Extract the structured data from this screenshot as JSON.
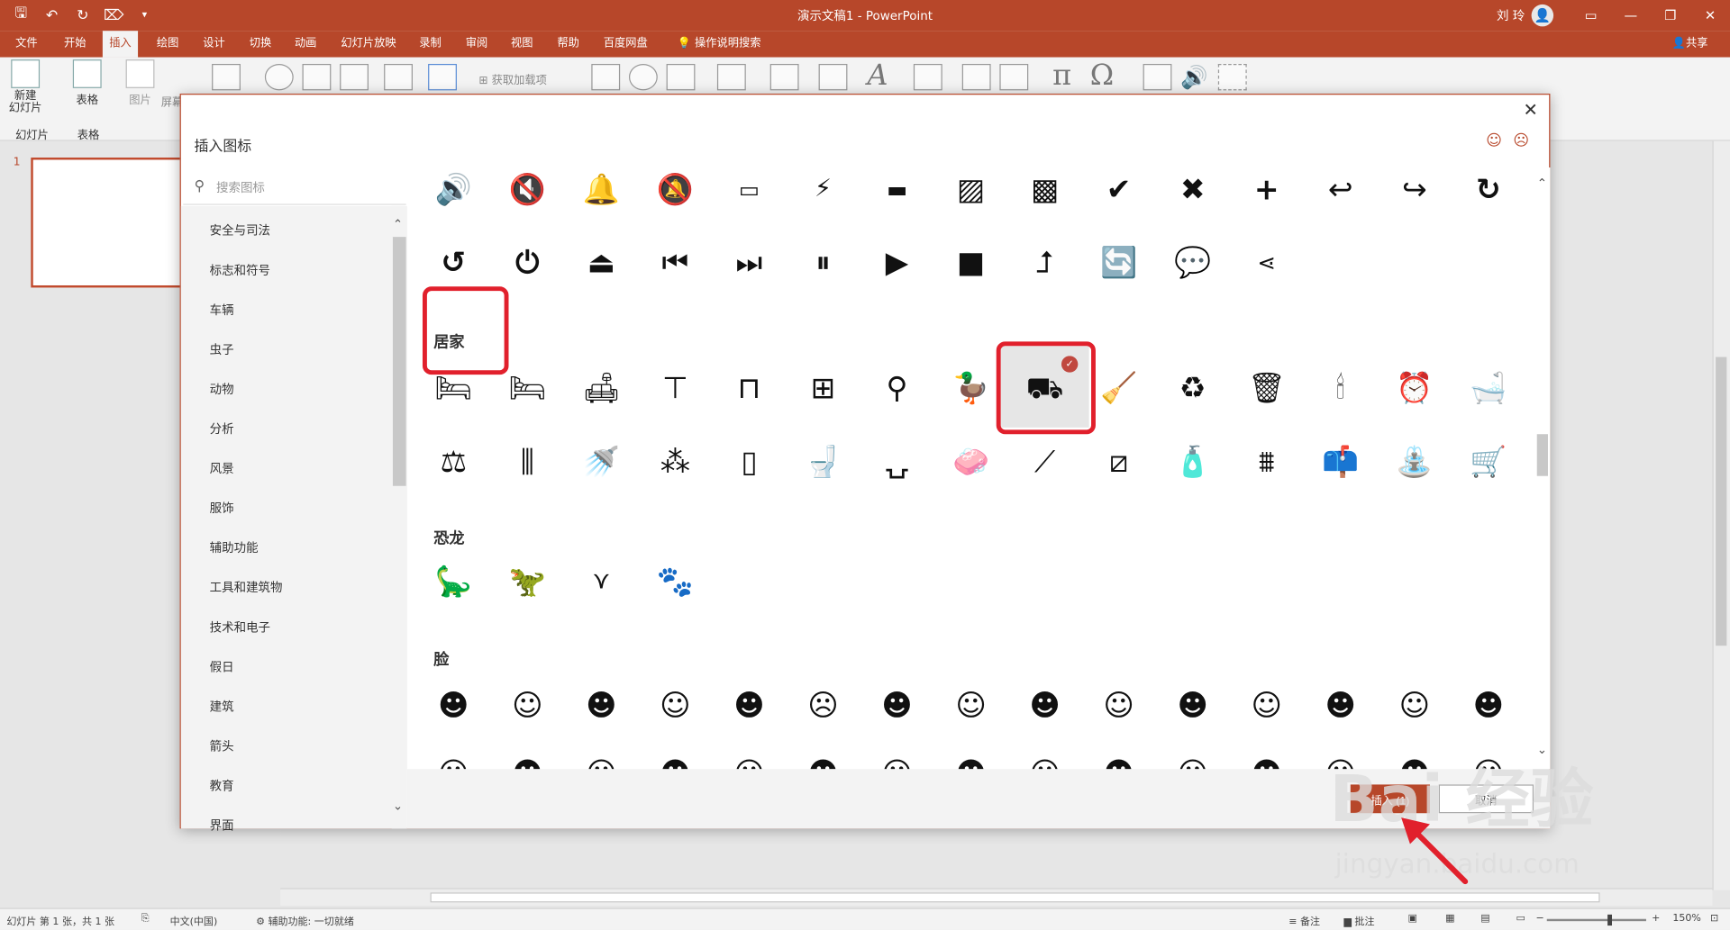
{
  "titlebar": {
    "doc_title": "演示文稿1 - PowerPoint",
    "user_name": "刘 玲"
  },
  "tabs": [
    "文件",
    "开始",
    "插入",
    "绘图",
    "设计",
    "切换",
    "动画",
    "幻灯片放映",
    "录制",
    "审阅",
    "视图",
    "帮助",
    "百度网盘",
    "操作说明搜索"
  ],
  "share_label": "共享",
  "ribbon": {
    "new_slide": "新建\n幻灯片",
    "slide_group": "幻灯片",
    "table": "表格",
    "table_group": "表格",
    "picture": "图片",
    "screenshot": "屏幕",
    "get_addins": "获取加载项"
  },
  "slide_panel": {
    "number": "1"
  },
  "dialog": {
    "title": "插入图标",
    "search_placeholder": "搜索图标",
    "categories": [
      "安全与司法",
      "标志和符号",
      "车辆",
      "虫子",
      "动物",
      "分析",
      "风景",
      "服饰",
      "辅助功能",
      "工具和建筑物",
      "技术和电子",
      "假日",
      "建筑",
      "箭头",
      "教育",
      "界面"
    ],
    "sections": {
      "home": "居家",
      "dinosaur": "恐龙",
      "face": "脸"
    },
    "insert_label": "插入 (1)",
    "cancel_label": "取消"
  },
  "statusbar": {
    "slide_info": "幻灯片 第 1 张，共 1 张",
    "language": "中文(中国)",
    "accessibility": "辅助功能: 一切就绪",
    "notes": "备注",
    "comments": "批注",
    "zoom": "150%"
  },
  "watermark": {
    "brand": "Bai 经验",
    "url": "jingyan.baidu.com"
  },
  "accent_color": "#b7472a",
  "highlight_color": "#e1202c"
}
